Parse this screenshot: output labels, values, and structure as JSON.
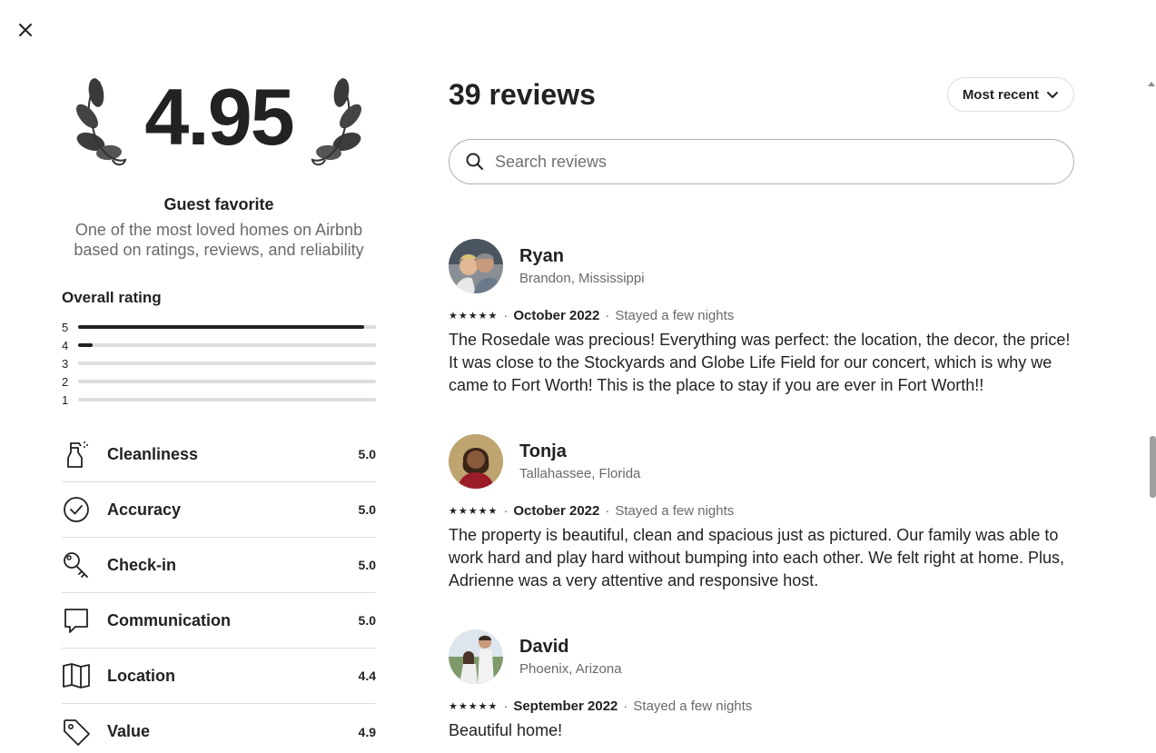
{
  "modal": {
    "close_icon": "close-icon"
  },
  "summary": {
    "score": "4.95",
    "guest_favorite_title": "Guest favorite",
    "guest_favorite_desc_line1": "One of the most loved homes on Airbnb",
    "guest_favorite_desc_line2": "based on ratings, reviews, and reliability",
    "overall_title": "Overall rating",
    "distribution": [
      {
        "stars": "5",
        "fraction": 0.96
      },
      {
        "stars": "4",
        "fraction": 0.05
      },
      {
        "stars": "3",
        "fraction": 0
      },
      {
        "stars": "2",
        "fraction": 0
      },
      {
        "stars": "1",
        "fraction": 0
      }
    ],
    "categories": [
      {
        "label": "Cleanliness",
        "value": "5.0",
        "icon": "spray-bottle-icon"
      },
      {
        "label": "Accuracy",
        "value": "5.0",
        "icon": "check-circle-icon"
      },
      {
        "label": "Check-in",
        "value": "5.0",
        "icon": "key-icon"
      },
      {
        "label": "Communication",
        "value": "5.0",
        "icon": "chat-bubble-icon"
      },
      {
        "label": "Location",
        "value": "4.4",
        "icon": "map-icon"
      },
      {
        "label": "Value",
        "value": "4.9",
        "icon": "tag-icon"
      }
    ]
  },
  "reviews_panel": {
    "count_title": "39 reviews",
    "sort_label": "Most recent",
    "search_placeholder": "Search reviews",
    "reviews": [
      {
        "name": "Ryan",
        "location": "Brandon, Mississippi",
        "stars": "★★★★★",
        "date": "October 2022",
        "stay": "Stayed a few nights",
        "text": "The Rosedale was precious! Everything was perfect: the location, the decor, the price! It was close to the Stockyards and Globe Life Field for our concert, which is why we came to Fort Worth! This is the place to stay if you are ever in Fort Worth!!"
      },
      {
        "name": "Tonja",
        "location": "Tallahassee, Florida",
        "stars": "★★★★★",
        "date": "October 2022",
        "stay": "Stayed a few nights",
        "text": "The property is beautiful, clean and spacious just as pictured. Our family was able to work hard and play hard without bumping into each other. We felt right at home. Plus, Adrienne was a very attentive and responsive host."
      },
      {
        "name": "David",
        "location": "Phoenix, Arizona",
        "stars": "★★★★★",
        "date": "September 2022",
        "stay": "Stayed a few nights",
        "text": "Beautiful home!"
      }
    ]
  },
  "colors": {
    "text": "#222222",
    "muted": "#6a6a6a",
    "divider": "#dddddd"
  }
}
